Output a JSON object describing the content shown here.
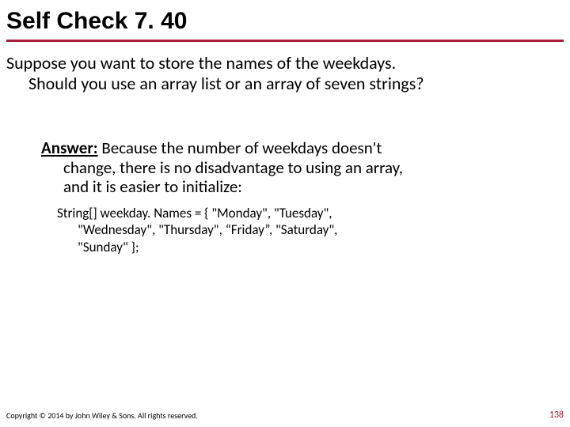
{
  "title": "Self Check 7. 40",
  "question_line1": "Suppose you want to store the names of the weekdays.",
  "question_line2": "Should you use an array list or an array of seven strings?",
  "answer_label": "Answer:",
  "answer_line1": " Because the number of weekdays doesn't",
  "answer_line2": "change, there is no disadvantage to using an array,",
  "answer_line3": "and it is easier to initialize:",
  "code_line1": "String[] weekday. Names = { \"Monday\", \"Tuesday\",",
  "code_line2": "\"Wednesday\", \"Thursday\", “Friday”, \"Saturday\",",
  "code_line3": "\"Sunday\" };",
  "copyright": "Copyright © 2014 by John Wiley & Sons. All rights reserved.",
  "page_number": "138"
}
